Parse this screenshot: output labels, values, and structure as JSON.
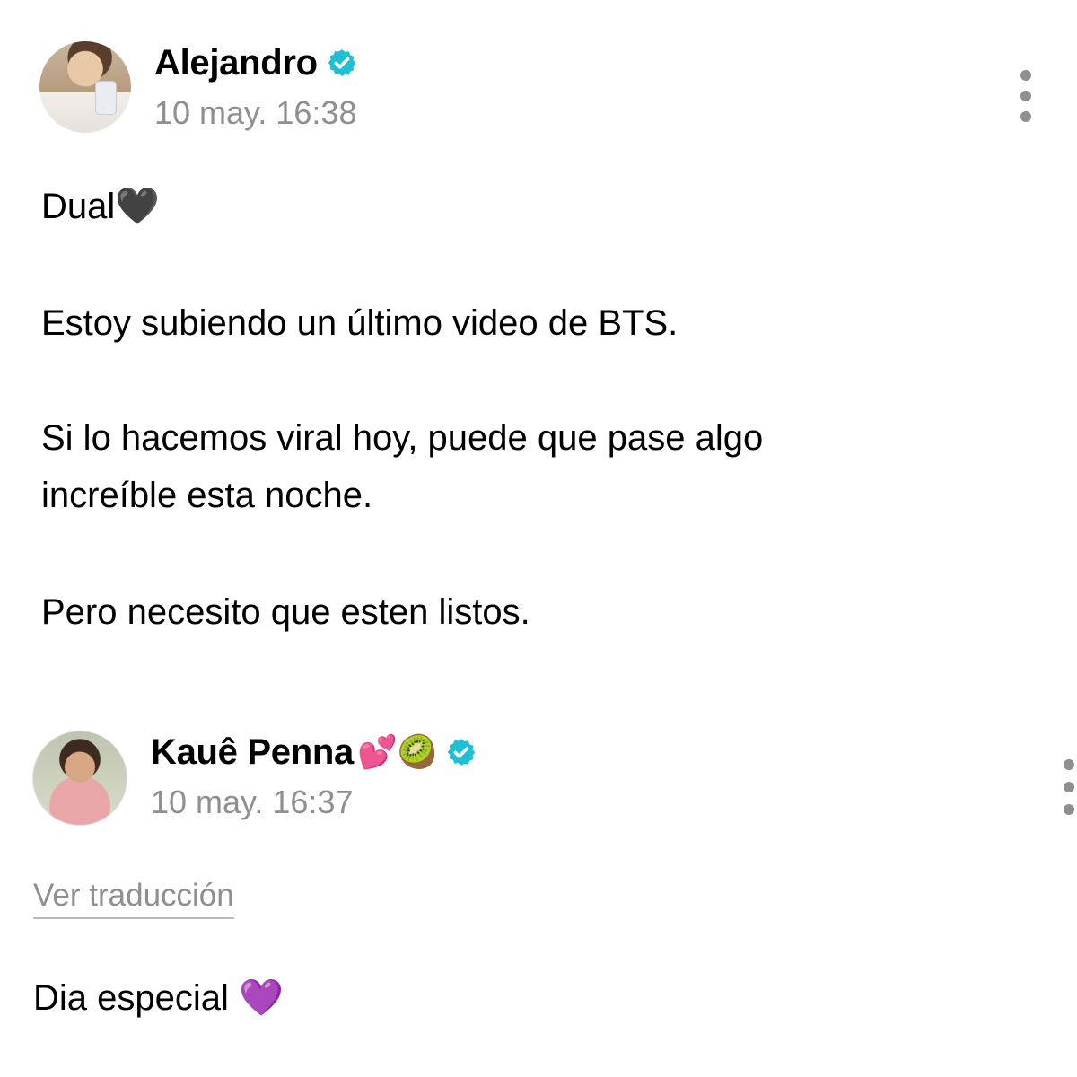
{
  "posts": [
    {
      "author": "Alejandro",
      "verified": true,
      "timestamp": "10 may. 16:38",
      "lines": [
        "Dual🖤",
        "Estoy subiendo un último video de BTS.",
        "Si lo hacemos viral hoy, puede que pase algo",
        "increíble esta noche.",
        "Pero necesito que esten listos."
      ]
    },
    {
      "author": "Kauê Penna",
      "author_emojis": "💕🥝",
      "verified": true,
      "timestamp": "10 may. 16:37",
      "translate_link": "Ver traducción",
      "lines": [
        "Dia especial 💜"
      ]
    }
  ],
  "colors": {
    "verified_badge": "#1ec0d8",
    "secondary_text": "#8e8e93"
  },
  "icons": {
    "verified": "verified-badge-icon",
    "more": "more-options-icon"
  }
}
